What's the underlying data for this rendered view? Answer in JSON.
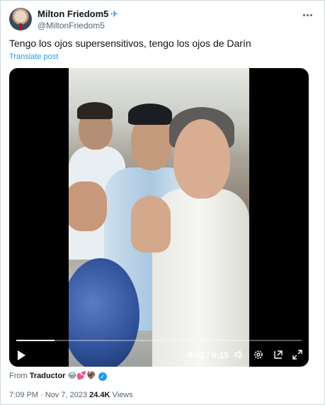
{
  "post": {
    "author_name": "Milton Friedom5",
    "author_handle": "@MiltonFriedom5",
    "text": "Tengo los ojos supersensitivos, tengo los ojos de Darín",
    "translate_label": "Translate post"
  },
  "video": {
    "current_time": "0:02",
    "duration": "0:15",
    "time_display": "0:02 / 0:15",
    "progress_fraction": 0.133
  },
  "source": {
    "from_label": "From",
    "app_name": "Traductor",
    "emojis": "😂💕🦃"
  },
  "meta": {
    "time": "7:09 PM",
    "separator": " · ",
    "date": "Nov 7, 2023",
    "views_count": "24.4K",
    "views_label": "Views"
  },
  "icons": {
    "name_badge": "airplane-icon",
    "more": "more-horizontal-icon",
    "play": "play-icon",
    "volume": "volume-icon",
    "settings": "settings-icon",
    "pip": "picture-in-picture-icon",
    "fullscreen": "fullscreen-icon",
    "verified": "verified-badge-icon"
  },
  "colors": {
    "link": "#1d9bf0",
    "secondary_text": "#536471",
    "primary_text": "#0f1419"
  }
}
